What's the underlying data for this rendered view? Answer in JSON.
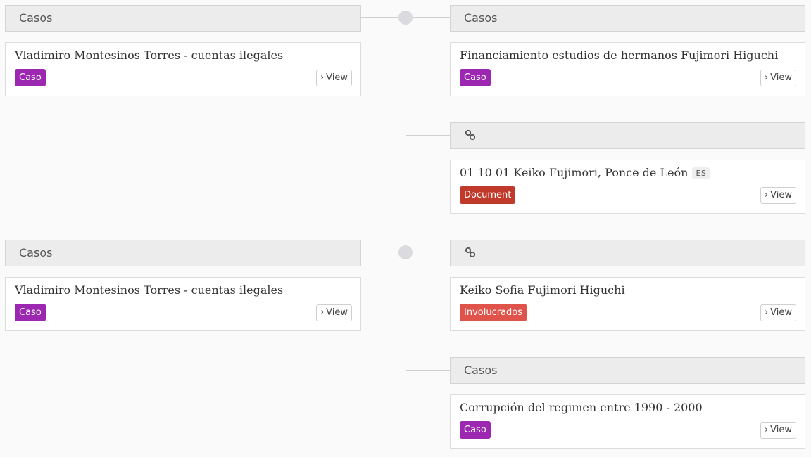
{
  "view_label": "View",
  "groups": [
    {
      "source": {
        "header": "Casos",
        "card": {
          "title": "Vladimiro Montesinos Torres - cuentas ilegales",
          "badge": "Caso",
          "badge_color": "#9c27b0"
        }
      },
      "targets": [
        {
          "header": "Casos",
          "header_icon": null,
          "card": {
            "title": "Financiamiento estudios de hermanos Fujimori Higuchi",
            "badge": "Caso",
            "badge_color": "#9c27b0"
          }
        },
        {
          "header": "",
          "header_icon": "link-icon",
          "card": {
            "title": "01 10 01 Keiko Fujimori, Ponce de León",
            "lang": "ES",
            "badge": "Document",
            "badge_color": "#c0392b"
          }
        }
      ]
    },
    {
      "source": {
        "header": "Casos",
        "card": {
          "title": "Vladimiro Montesinos Torres - cuentas ilegales",
          "badge": "Caso",
          "badge_color": "#9c27b0"
        }
      },
      "targets": [
        {
          "header": "",
          "header_icon": "link-icon",
          "card": {
            "title": "Keiko Sofia Fujimori Higuchi",
            "badge": "Involucrados",
            "badge_color": "#e0534a"
          }
        },
        {
          "header": "Casos",
          "header_icon": null,
          "card": {
            "title": "Corrupción del regimen entre 1990 - 2000",
            "badge": "Caso",
            "badge_color": "#9c27b0"
          }
        }
      ]
    }
  ]
}
